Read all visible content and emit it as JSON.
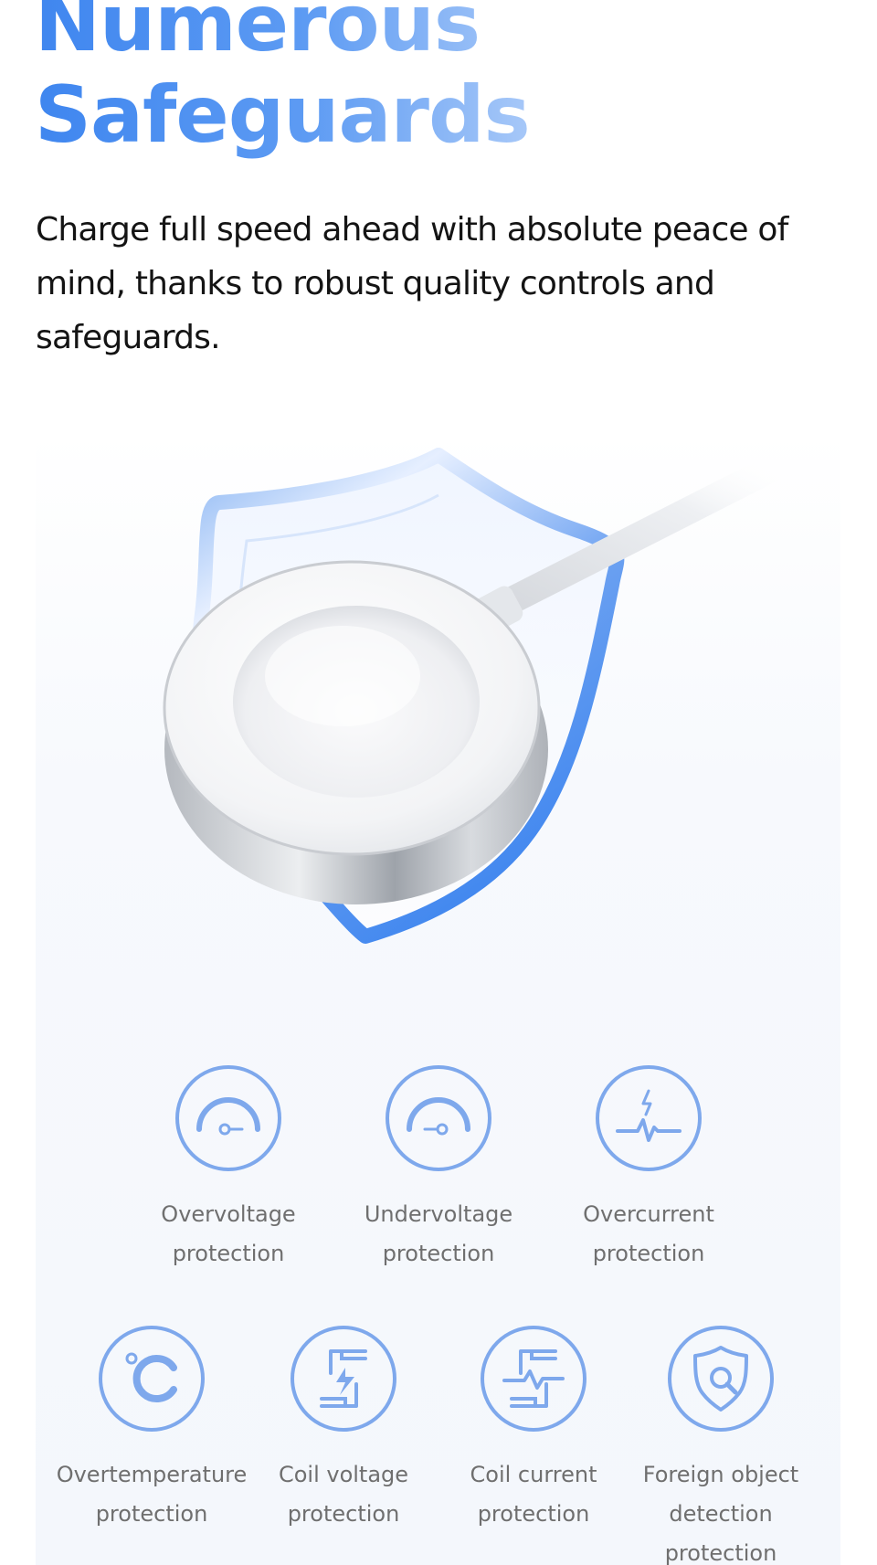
{
  "headline": {
    "line1": "Numerous",
    "line2": "Safeguards"
  },
  "intro": "Charge full speed ahead with absolute peace of mind, thanks to robust quality controls and safeguards.",
  "colors": {
    "accent": "#4a8cf0",
    "accent_light": "#a7c8f8",
    "icon_ring": "#7ea8ec",
    "text": "#141414",
    "label": "#6f6f6f"
  },
  "features": [
    {
      "icon": "gauge-high-icon",
      "line1": "Overvoltage",
      "line2": "protection"
    },
    {
      "icon": "gauge-low-icon",
      "line1": "Undervoltage",
      "line2": "protection"
    },
    {
      "icon": "lightning-pulse-icon",
      "line1": "Overcurrent",
      "line2": "protection"
    },
    {
      "icon": "celsius-icon",
      "line1": "Overtemperature",
      "line2": "protection"
    },
    {
      "icon": "coil-voltage-icon",
      "line1": "Coil voltage",
      "line2": "protection"
    },
    {
      "icon": "coil-current-icon",
      "line1": "Coil current",
      "line2": "protection"
    },
    {
      "icon": "shield-search-icon",
      "line1": "Foreign object",
      "line2": "detection",
      "line3": "protection"
    }
  ]
}
